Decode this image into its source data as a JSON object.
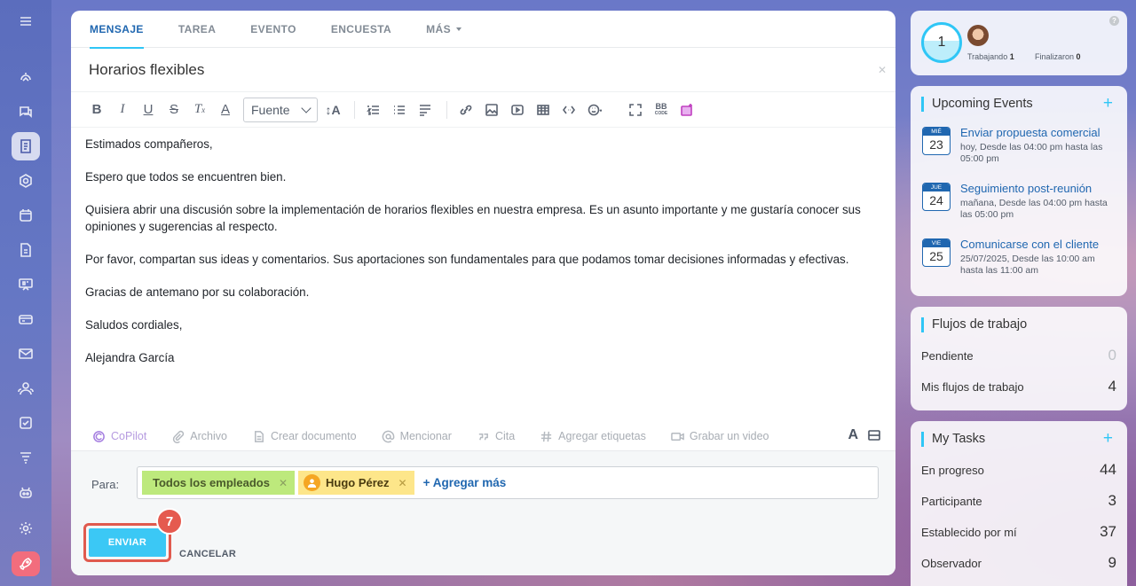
{
  "tabs": [
    "MENSAJE",
    "TAREA",
    "EVENTO",
    "ENCUESTA",
    "MÁS"
  ],
  "post": {
    "title": "Horarios flexibles",
    "font_select": "Fuente",
    "paragraphs": [
      "Estimados compañeros,",
      "Espero que todos se encuentren bien.",
      "Quisiera abrir una discusión sobre la implementación de horarios flexibles en nuestra empresa. Es un asunto importante y me gustaría conocer sus opiniones y sugerencias al respecto.",
      "Por favor, compartan sus ideas y comentarios. Sus aportaciones son fundamentales para que podamos tomar decisiones informadas y efectivas.",
      "Gracias de antemano por su colaboración.",
      "Saludos cordiales,",
      "Alejandra García"
    ]
  },
  "actions": {
    "copilot": "CoPilot",
    "file": "Archivo",
    "create_doc": "Crear documento",
    "mention": "Mencionar",
    "quote": "Cita",
    "tags": "Agregar etiquetas",
    "video": "Grabar un video",
    "text_size": "A"
  },
  "recipients": {
    "label": "Para:",
    "chips": [
      "Todos los empleados",
      "Hugo Pérez"
    ],
    "add_more": "+ Agregar más"
  },
  "footer": {
    "send": "ENVIAR",
    "cancel": "CANCELAR",
    "step_badge": "7"
  },
  "status": {
    "count": "1",
    "working_label": "Trabajando",
    "working_value": "1",
    "finished_label": "Finalizaron",
    "finished_value": "0"
  },
  "events": {
    "title": "Upcoming Events",
    "items": [
      {
        "month": "MIÉ",
        "day": "23",
        "title": "Enviar propuesta comercial",
        "when": "hoy, Desde las 04:00 pm hasta las 05:00 pm"
      },
      {
        "month": "JUE",
        "day": "24",
        "title": "Seguimiento post-reunión",
        "when": "mañana, Desde las 04:00 pm hasta las 05:00 pm"
      },
      {
        "month": "VIE",
        "day": "25",
        "title": "Comunicarse con el cliente",
        "when": "25/07/2025, Desde las 10:00 am hasta las 11:00 am"
      }
    ]
  },
  "workflows": {
    "title": "Flujos de trabajo",
    "rows": [
      {
        "label": "Pendiente",
        "value": "0"
      },
      {
        "label": "Mis flujos de trabajo",
        "value": "4"
      }
    ]
  },
  "tasks": {
    "title": "My Tasks",
    "rows": [
      {
        "label": "En progreso",
        "value": "44"
      },
      {
        "label": "Participante",
        "value": "3"
      },
      {
        "label": "Establecido por mí",
        "value": "37"
      },
      {
        "label": "Observador",
        "value": "9"
      }
    ]
  },
  "colors": {
    "accent": "#2fc6f6",
    "link": "#2067b0",
    "send_button": "#3bc8f5",
    "highlight": "#e05a4e"
  }
}
